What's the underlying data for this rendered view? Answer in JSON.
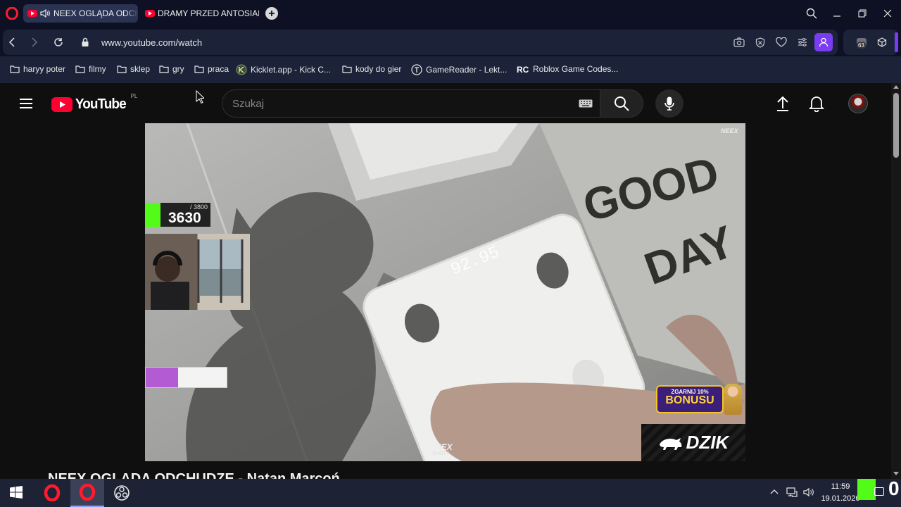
{
  "browser": {
    "tabs": [
      {
        "label": "NEEX OGLĄDA ODCHO",
        "active": true
      },
      {
        "label": "DRAMY PRZED ANTOSIAM",
        "active": false
      }
    ],
    "url": "www.youtube.com/watch",
    "extension_badge": "63",
    "accent": "#ff1b2d"
  },
  "bookmarks": [
    {
      "label": "haryy poter",
      "icon": "folder-icon"
    },
    {
      "label": "filmy",
      "icon": "folder-icon"
    },
    {
      "label": "sklep",
      "icon": "folder-icon"
    },
    {
      "label": "gry",
      "icon": "folder-icon"
    },
    {
      "label": "praca",
      "icon": "folder-icon"
    },
    {
      "label": "Kicklet.app - Kick C...",
      "icon": "kicklet-icon"
    },
    {
      "label": "kody do gier",
      "icon": "folder-icon"
    },
    {
      "label": "GameReader - Lekt...",
      "icon": "gamereader-icon"
    },
    {
      "label": "Roblox Game Codes...",
      "icon": "rc-icon"
    }
  ],
  "youtube": {
    "logo_text": "YouTube",
    "country_code": "PL",
    "search_placeholder": "Szukaj",
    "video_title": "NEEX OGLĄDA ODCHUDZE - Natan Marcoń"
  },
  "video_overlays": {
    "kick_goal": "/ 3800",
    "kick_count": "3630",
    "scale_readout": "92.95",
    "mat_text_1": "GOOD",
    "mat_text_2": "DAY",
    "watermark": "NEEX",
    "watermark_sub": "SHOTY",
    "bonus_top": "ZGARNIJ 10%",
    "bonus_main": "BONUSU",
    "sponsor": "DZIK"
  },
  "taskbar": {
    "time": "11:59",
    "date": "19.01.2026",
    "kick_count": "0"
  }
}
